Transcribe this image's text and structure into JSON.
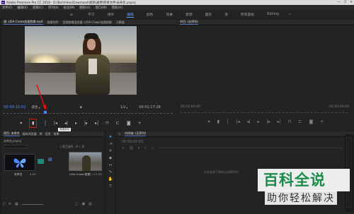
{
  "window": {
    "title": "Adobe Premiere Pro CC 2018 - D:\\Bai\\Video\\Download\\视频\\通用\\项目文件\\未命名.prproj",
    "app_icon_text": "Pr",
    "buttons": [
      "—",
      "☐",
      "✕"
    ]
  },
  "menu": [
    "文件(F)",
    "编辑(E)",
    "剪辑(C)",
    "序列(S)",
    "标记(M)",
    "图形(G)",
    "窗口(W)",
    "帮助(H)"
  ],
  "workspaces": {
    "home_icon": "home-icon",
    "items": [
      "学习",
      "组件",
      "编辑",
      "颜色",
      "效果",
      "音频",
      "图形",
      "库",
      "所有面板",
      "Editing"
    ],
    "active": "编辑",
    "more": "»"
  },
  "source_panel": {
    "tabs": [
      "源: LISA Crown加速剪辑.mp4",
      "效果控件",
      "音频剪辑混合器: LISA Crown加速剪辑",
      "元数据"
    ],
    "timecode_left": "00:00:10:02",
    "fit": "适合",
    "scale": "1/2",
    "timecode_right": "00:01:17:26",
    "tooltip": "添加标记",
    "playhead_fraction": 0.25,
    "buttons": [
      "mark-in-icon",
      "add-marker-icon",
      "mark-out-icon",
      "go-to-in-icon",
      "step-back-icon",
      "play-icon",
      "step-forward-icon",
      "go-to-out-icon",
      "insert-icon",
      "overwrite-icon",
      "export-frame-icon"
    ]
  },
  "program_panel": {
    "tab": "节目: (无序列)",
    "timecode_left": "00:00:00:00",
    "timecode_right": "00:00:00:00"
  },
  "project_panel": {
    "tabs": [
      "项目: 未命名",
      "媒体浏览器",
      "库",
      "信息",
      "效果"
    ],
    "project_file": "未命名.prproj",
    "item_count": "1 项已选择，共 2 项",
    "items": [
      {
        "name": "未命名",
        "duration": "4:20"
      },
      {
        "name": "LISA Crown加速剪辑...",
        "duration": "1:17:26"
      }
    ]
  },
  "tools": [
    "selection-tool-icon",
    "track-select-icon",
    "ripple-edit-icon",
    "razor-icon",
    "slip-icon",
    "pen-icon",
    "hand-icon",
    "type-icon"
  ],
  "timeline_panel": {
    "tab": "时间轴: (无序列)",
    "timecode": "00:00:00:00",
    "empty_text": "在此处放下媒体以创建序列。"
  },
  "watermark": {
    "title": "百科全说",
    "subtitle": "助你轻松解决"
  },
  "colors": {
    "accent_blue": "#4a8cff",
    "annotation_red": "#e01010",
    "watermark_green": "#1a8c4a"
  }
}
